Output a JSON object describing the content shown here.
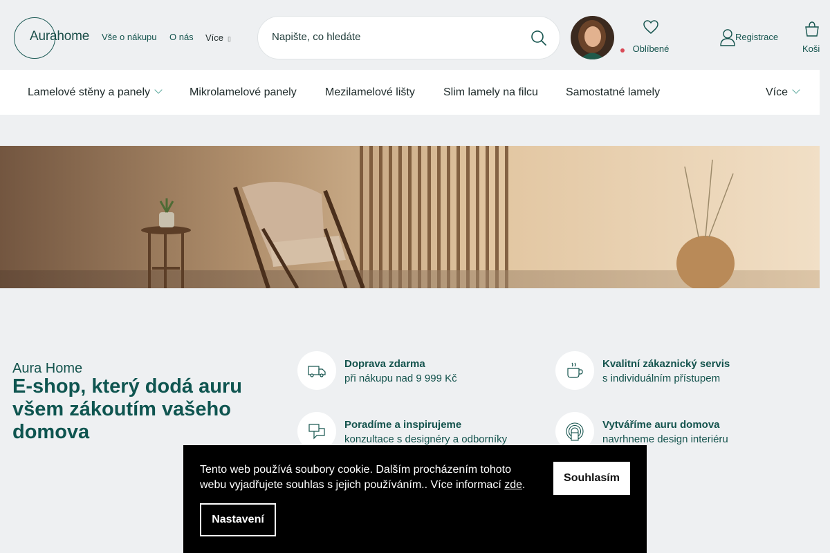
{
  "brand": {
    "logo_text": "Aurahome"
  },
  "header": {
    "links": [
      {
        "label": "Vše o nákupu"
      },
      {
        "label": "O nás"
      }
    ],
    "more_label": "Více",
    "more_arrow": "▯",
    "search": {
      "placeholder": "Napište, co hledáte",
      "icon": "search-icon"
    },
    "favorites_label": "Oblíbené",
    "register_label": "Registrace",
    "cart_label": "Koši"
  },
  "categories": [
    {
      "label": "Lamelové stěny a panely",
      "has_dropdown": true
    },
    {
      "label": "Mikrolamelové panely"
    },
    {
      "label": "Mezilamelové lišty"
    },
    {
      "label": "Slim lamely na filcu"
    },
    {
      "label": "Samostatné lamely"
    }
  ],
  "categories_more_label": "Více",
  "intro": {
    "subtitle": "Aura Home",
    "title": "E-shop, který dodá auru všem zákoutím vašeho domova"
  },
  "features": [
    {
      "icon": "truck-icon",
      "title": "Doprava zdarma",
      "desc": "při nákupu nad 9 999 Kč"
    },
    {
      "icon": "cup-icon",
      "title": "Kvalitní zákaznický servis",
      "desc": "s individuálním přístupem"
    },
    {
      "icon": "chat-icon",
      "title": "Poradíme a inspirujeme",
      "desc": "konzultace s designéry a odborníky"
    },
    {
      "icon": "aura-icon",
      "title": "Vytváříme auru domova",
      "desc": "navrhneme design interiéru"
    }
  ],
  "cookie": {
    "text": "Tento web používá soubory cookie. Dalším procházením tohoto webu vyjadřujete souhlas s jejich používáním.. Více informací",
    "link": "zde",
    "text_end": ".",
    "accept": "Souhlasím",
    "settings": "Nastavení"
  },
  "colors": {
    "brand": "#14534d",
    "accent_dot": "#d94a57",
    "cookie_bg": "#000000"
  }
}
